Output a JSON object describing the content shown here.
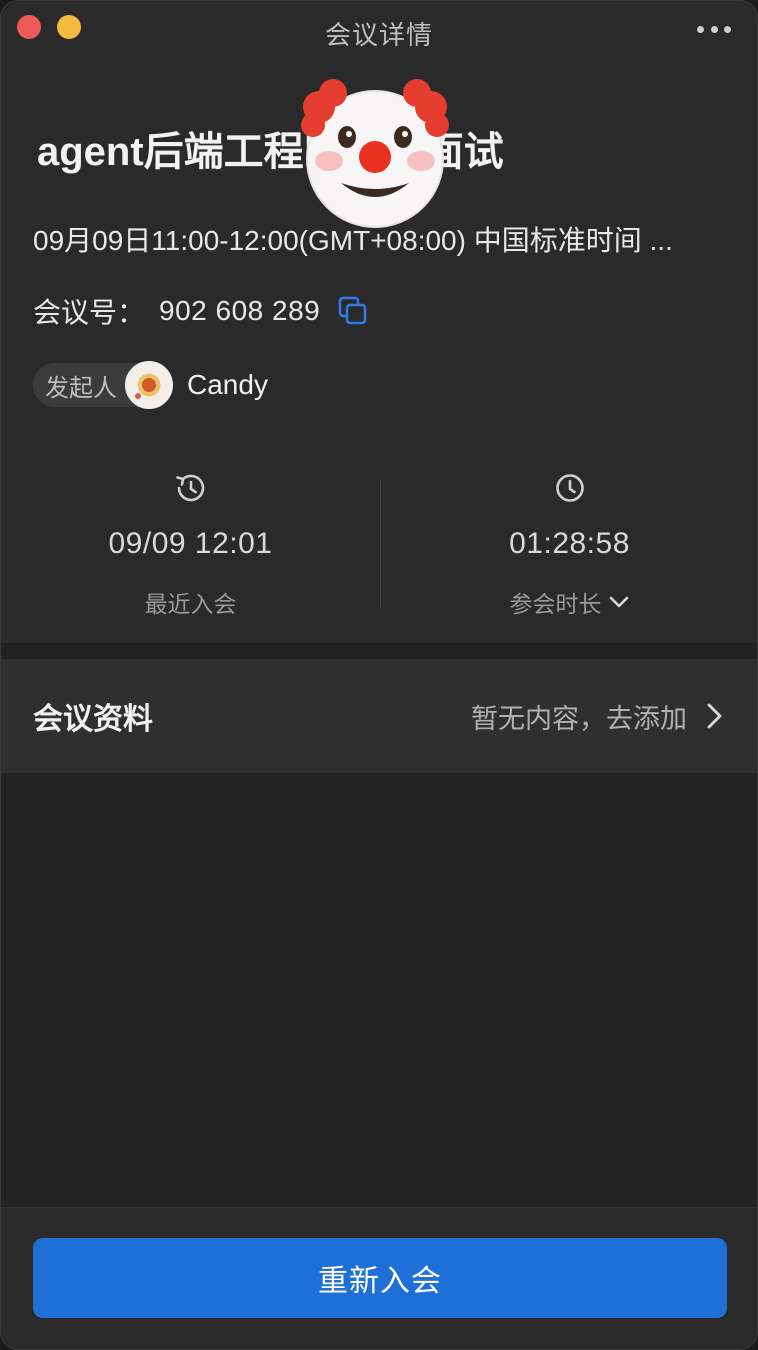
{
  "window": {
    "title": "会议详情"
  },
  "meeting": {
    "title": "agent后端工程师线上面试",
    "time": "09月09日11:00-12:00(GMT+08:00) 中国标准时间 ...",
    "id_label": "会议号：",
    "id_value": "902 608 289",
    "host_label": "发起人",
    "host_name": "Candy"
  },
  "stats": {
    "last_join": {
      "value": "09/09 12:01",
      "label": "最近入会",
      "icon": "history-icon"
    },
    "duration": {
      "value": "01:28:58",
      "label": "参会时长",
      "icon": "clock-icon"
    }
  },
  "materials": {
    "title": "会议资料",
    "action": "暂无内容，去添加"
  },
  "footer": {
    "rejoin_label": "重新入会"
  },
  "colors": {
    "accent": "#1e6fd6",
    "background": "#2a2a2b",
    "close": "#ee5b56",
    "minimize": "#f4bb3d"
  }
}
